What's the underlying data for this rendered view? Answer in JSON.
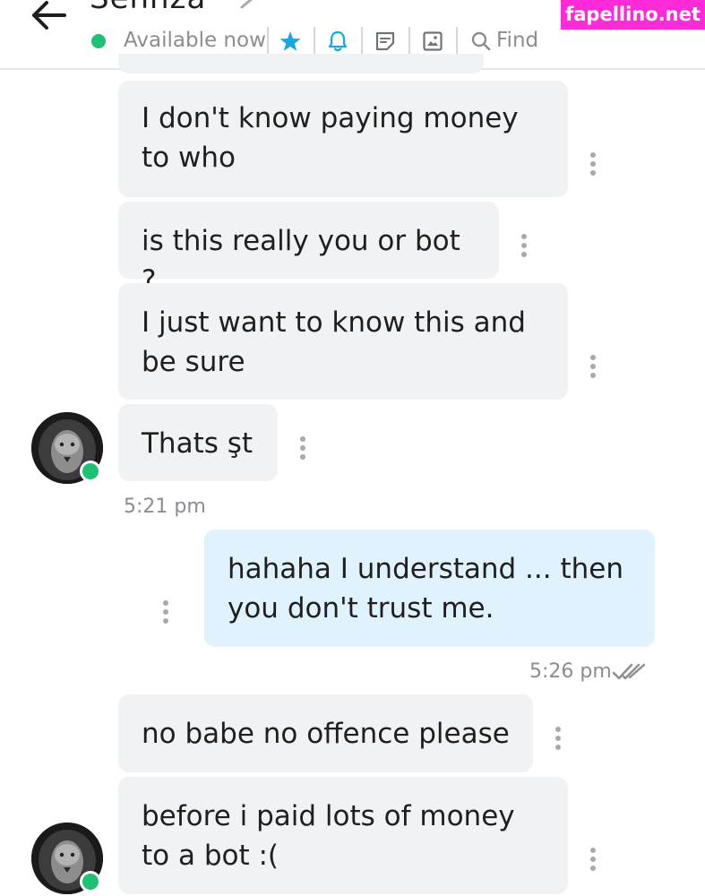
{
  "header": {
    "contact_name": "Sehnza",
    "status": "Available now",
    "find_label": "Find",
    "watermark": "fapellino.net"
  },
  "messages": [
    {
      "text": "I don't know paying money to who"
    },
    {
      "text": "is this really you or bot ?"
    },
    {
      "text": "I just want to know this and be sure"
    },
    {
      "text": "Thats şt"
    },
    {
      "time": "5:21 pm"
    },
    {
      "text": "hahaha I understand ... then you don't trust me."
    },
    {
      "time": "5:26 pm"
    },
    {
      "text": "no babe no offence please"
    },
    {
      "text": "before i paid lots of money to a bot :("
    }
  ],
  "colors": {
    "incoming_bubble": "#f0f2f4",
    "outgoing_bubble": "#e0f2fd",
    "online": "#1fc173",
    "star": "#17a8e3",
    "watermark": "#ff2ad7"
  }
}
